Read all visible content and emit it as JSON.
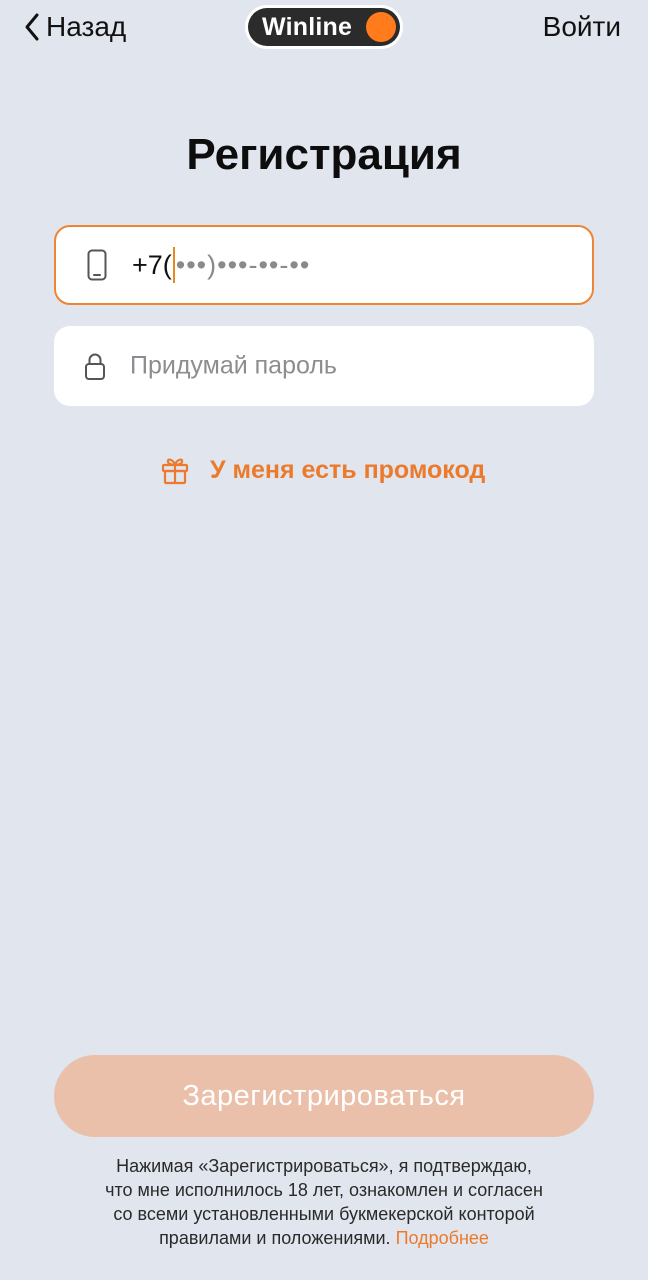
{
  "header": {
    "back_label": "Назад",
    "logo_text": "Winline",
    "login_label": "Войти"
  },
  "title": "Регистрация",
  "phone_field": {
    "prefix": "+7(",
    "mask": "•••)•••-••-••",
    "icon": "smartphone-icon"
  },
  "password_field": {
    "placeholder": "Придумай пароль",
    "icon": "lock-icon"
  },
  "promo": {
    "label": "У меня есть промокод",
    "icon": "gift-icon"
  },
  "register_button": {
    "label": "Зарегистрироваться",
    "state": "disabled"
  },
  "terms": {
    "line1": "Нажимая «Зарегистрироваться», я подтверждаю,",
    "line2": "что мне исполнилось 18 лет, ознакомлен и согласен",
    "line3": "со всеми установленными букмекерской конторой",
    "line4": "правилами и положениями.",
    "link_label": "Подробнее"
  },
  "colors": {
    "background": "#e1e5ee",
    "accent": "#ec7a2c",
    "focus_border": "#ee8434",
    "button_disabled": "#ebc0aa",
    "logo_dot": "#ff7b1c"
  }
}
